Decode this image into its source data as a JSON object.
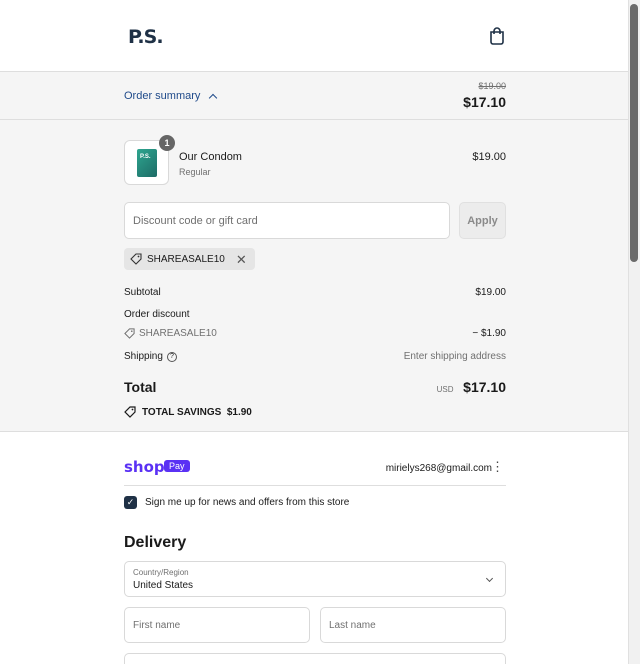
{
  "header": {
    "logo": "P.S."
  },
  "summary": {
    "toggle_label": "Order summary",
    "original_price": "$19.00",
    "price": "$17.10",
    "product": {
      "name": "Our Condom",
      "variant": "Regular",
      "price": "$19.00",
      "quantity": "1",
      "thumb_text": "P.S."
    },
    "discount": {
      "placeholder": "Discount code or gift card",
      "apply_label": "Apply",
      "applied_code": "SHAREASALE10"
    },
    "subtotal_label": "Subtotal",
    "subtotal_value": "$19.00",
    "order_discount_label": "Order discount",
    "discount_code": "SHAREASALE10",
    "discount_value": "− $1.90",
    "shipping_label": "Shipping",
    "shipping_value": "Enter shipping address",
    "total_label": "Total",
    "currency": "USD",
    "total_value": "$17.10",
    "savings": "TOTAL SAVINGS  $1.90"
  },
  "shop": {
    "logo": "shop",
    "pay_badge": "Pay",
    "email": "mirielys268@gmail.com"
  },
  "newsletter": {
    "label": "Sign me up for news and offers from this store",
    "checked": true
  },
  "delivery": {
    "heading": "Delivery",
    "country_label": "Country/Region",
    "country_value": "United States",
    "first_name_placeholder": "First name",
    "last_name_placeholder": "Last name"
  }
}
